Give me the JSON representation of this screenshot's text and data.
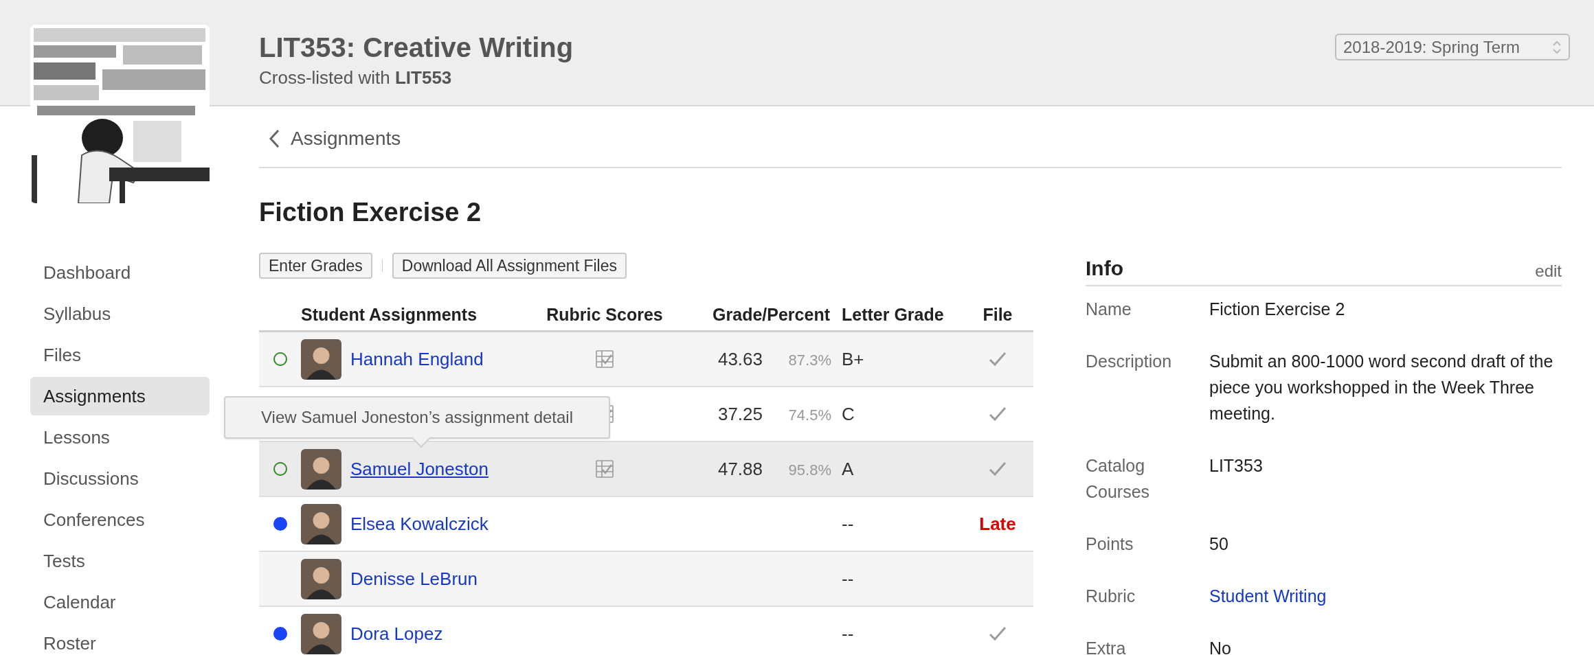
{
  "header": {
    "title": "LIT353: Creative Writing",
    "subtitle": "Cross-listed with **LIT553**",
    "term_select": {
      "value": "2018-2019: Spring Term"
    }
  },
  "sidebar": {
    "items": [
      {
        "label": "Dashboard",
        "selected": false
      },
      {
        "label": "Syllabus",
        "selected": false
      },
      {
        "label": "Files",
        "selected": false
      },
      {
        "label": "Assignments",
        "selected": true
      },
      {
        "label": "Lessons",
        "selected": false
      },
      {
        "label": "Discussions",
        "selected": false
      },
      {
        "label": "Conferences",
        "selected": false
      },
      {
        "label": "Tests",
        "selected": false
      },
      {
        "label": "Calendar",
        "selected": false
      },
      {
        "label": "Roster",
        "selected": false
      }
    ]
  },
  "breadcrumb": {
    "label": "Assignments"
  },
  "page_title": "Fiction Exercise 2",
  "buttons": [
    "Enter Grades",
    "Download All Assignment Files"
  ],
  "table": {
    "columns": [
      "Student Assignments",
      "Rubric Scores",
      "Grade/Percent",
      "Letter Grade",
      "File"
    ],
    "rows": [
      {
        "kind": "graded",
        "name": "Hannah England",
        "rubric": true,
        "grade": "43.63",
        "percent": "87.3%",
        "letter": "B+",
        "file": {
          "kind": "check"
        },
        "highlighted": false
      },
      {
        "rubric": true,
        "grade": "37.25",
        "percent": "74.5%",
        "letter": "C",
        "file": {
          "kind": "check"
        },
        "highlighted": false
      },
      {
        "kind": "graded",
        "name": "Samuel Joneston",
        "rubric": true,
        "grade": "47.88",
        "percent": "95.8%",
        "letter": "A",
        "file": {
          "kind": "check"
        },
        "highlighted": true
      },
      {
        "kind": "submitted",
        "name": "Elsea Kowalczick",
        "rubric": false,
        "letter": "--",
        "file": {
          "kind": "late",
          "text": "Late"
        },
        "highlighted": false
      },
      {
        "name": "Denisse LeBrun",
        "rubric": false,
        "letter": "--",
        "highlighted": false
      },
      {
        "kind": "submitted",
        "name": "Dora Lopez",
        "rubric": false,
        "letter": "--",
        "file": {
          "kind": "check"
        },
        "highlighted": false
      }
    ]
  },
  "tooltip": "View Samuel Joneston’s assignment detail",
  "info": {
    "title": "Info",
    "action": "edit",
    "fields": [
      {
        "label": "Name",
        "value": "Fiction Exercise 2"
      },
      {
        "label": "Description",
        "value": "Submit an 800-1000 word second draft of the piece you workshopped in the Week Three meeting."
      },
      {
        "label": "Catalog Courses",
        "value": "LIT353"
      },
      {
        "label": "Points",
        "value": "50"
      },
      {
        "label": "Rubric",
        "value": "Student Writing",
        "kind": "link"
      },
      {
        "label": "Extra",
        "value": "No"
      }
    ]
  }
}
